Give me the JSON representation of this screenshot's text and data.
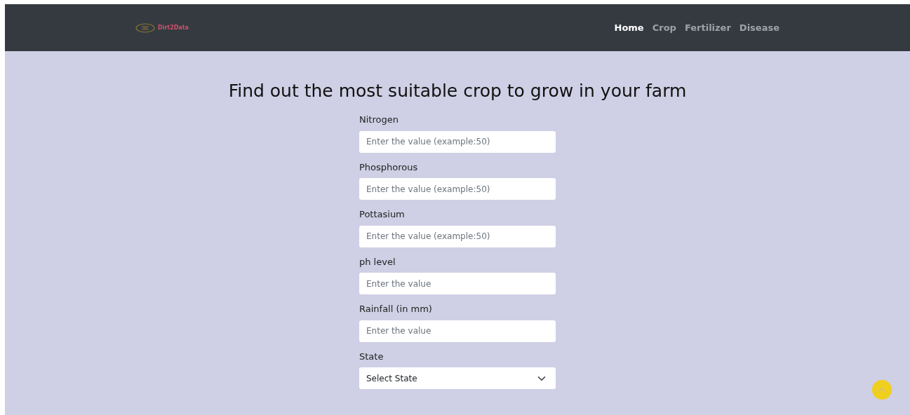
{
  "navbar": {
    "brand": "Dirt2Data",
    "links": [
      {
        "label": "Home",
        "selected": true
      },
      {
        "label": "Crop",
        "selected": false
      },
      {
        "label": "Fertilizer",
        "selected": false
      },
      {
        "label": "Disease",
        "selected": false
      }
    ]
  },
  "heading": "Find out the most suitable crop to grow in your farm",
  "fields": [
    {
      "kind": "input",
      "label": "Nitrogen",
      "placeholder": "Enter the value (example:50)"
    },
    {
      "kind": "input",
      "label": "Phosphorous",
      "placeholder": "Enter the value (example:50)"
    },
    {
      "kind": "input",
      "label": "Pottasium",
      "placeholder": "Enter the value (example:50)"
    },
    {
      "kind": "input",
      "label": "ph level",
      "placeholder": "Enter the value"
    },
    {
      "kind": "input",
      "label": "Rainfall (in mm)",
      "placeholder": "Enter the value"
    },
    {
      "kind": "select",
      "label": "State",
      "value": "Select State"
    }
  ]
}
